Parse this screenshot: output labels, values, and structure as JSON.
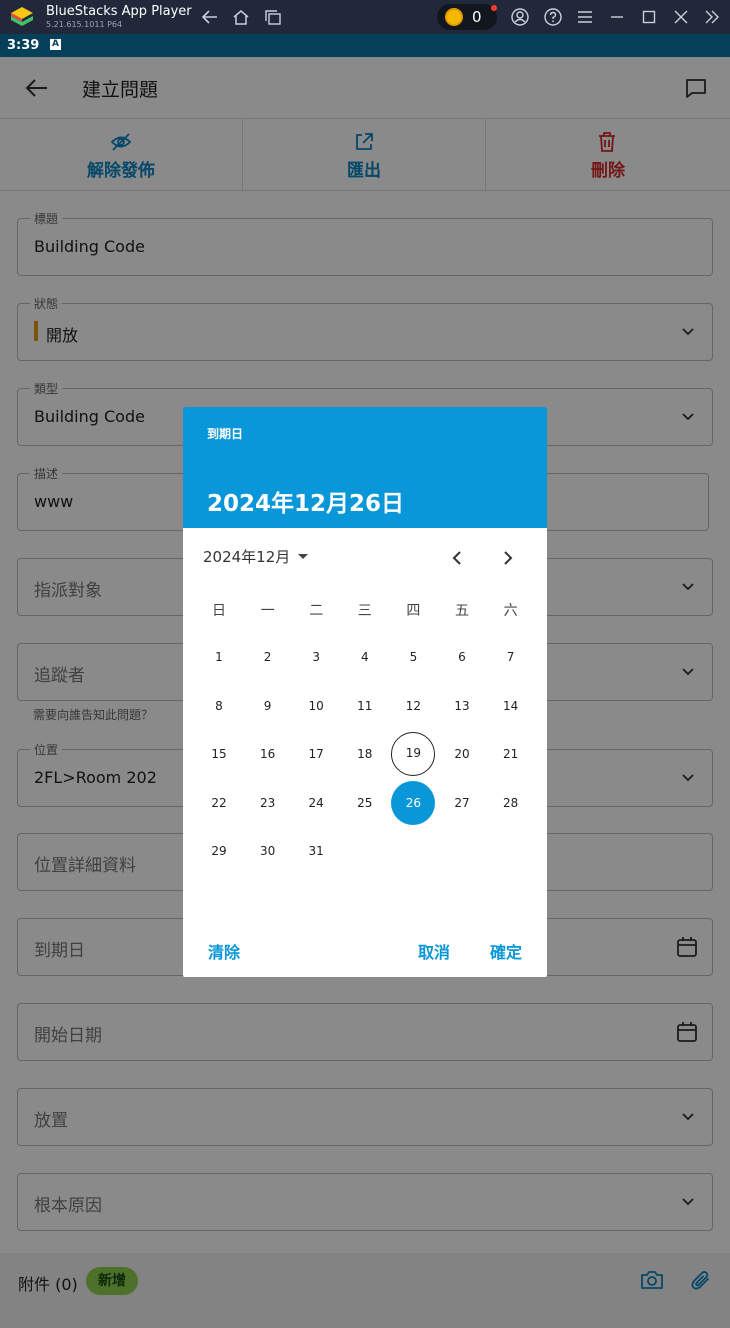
{
  "emulator": {
    "title": "BlueStacks App Player",
    "version": "5.21.615.1011  P64",
    "coin_count": "0"
  },
  "status_bar": {
    "time": "3:39",
    "icon_letter": "A"
  },
  "header": {
    "title": "建立問題"
  },
  "actions": [
    {
      "label": "解除發佈",
      "icon": "eye-off-icon",
      "color": "#0a86c4"
    },
    {
      "label": "匯出",
      "icon": "export-icon",
      "color": "#0a86c4"
    },
    {
      "label": "刪除",
      "icon": "trash-icon",
      "color": "#d42b2b"
    }
  ],
  "fields": {
    "title": {
      "label": "標題",
      "value": "Building Code"
    },
    "status": {
      "label": "狀態",
      "value": "開放"
    },
    "type": {
      "label": "類型",
      "value": "Building Code"
    },
    "description": {
      "label": "描述",
      "value": "www"
    },
    "assignee": {
      "placeholder": "指派對象"
    },
    "watchers": {
      "placeholder": "追蹤者",
      "hint": "需要向誰告知此問題？"
    },
    "location": {
      "label": "位置",
      "value": "2FL>Room 202"
    },
    "location_details": {
      "placeholder": "位置詳細資料"
    },
    "due_date": {
      "placeholder": "到期日"
    },
    "start_date": {
      "placeholder": "開始日期"
    },
    "placement": {
      "placeholder": "放置"
    },
    "root_cause": {
      "placeholder": "根本原因"
    }
  },
  "attachments": {
    "label": "附件 (0)",
    "add_label": "新增"
  },
  "datepicker": {
    "header_label": "到期日",
    "selected_date_text": "2024年12月26日",
    "month_label": "2024年12月",
    "weekdays": [
      "日",
      "一",
      "二",
      "三",
      "四",
      "五",
      "六"
    ],
    "first_weekday_index": 0,
    "days_in_month": 31,
    "today": 19,
    "selected": 26,
    "accent_color": "#0a97d9",
    "buttons": {
      "clear": "清除",
      "cancel": "取消",
      "ok": "確定"
    }
  }
}
